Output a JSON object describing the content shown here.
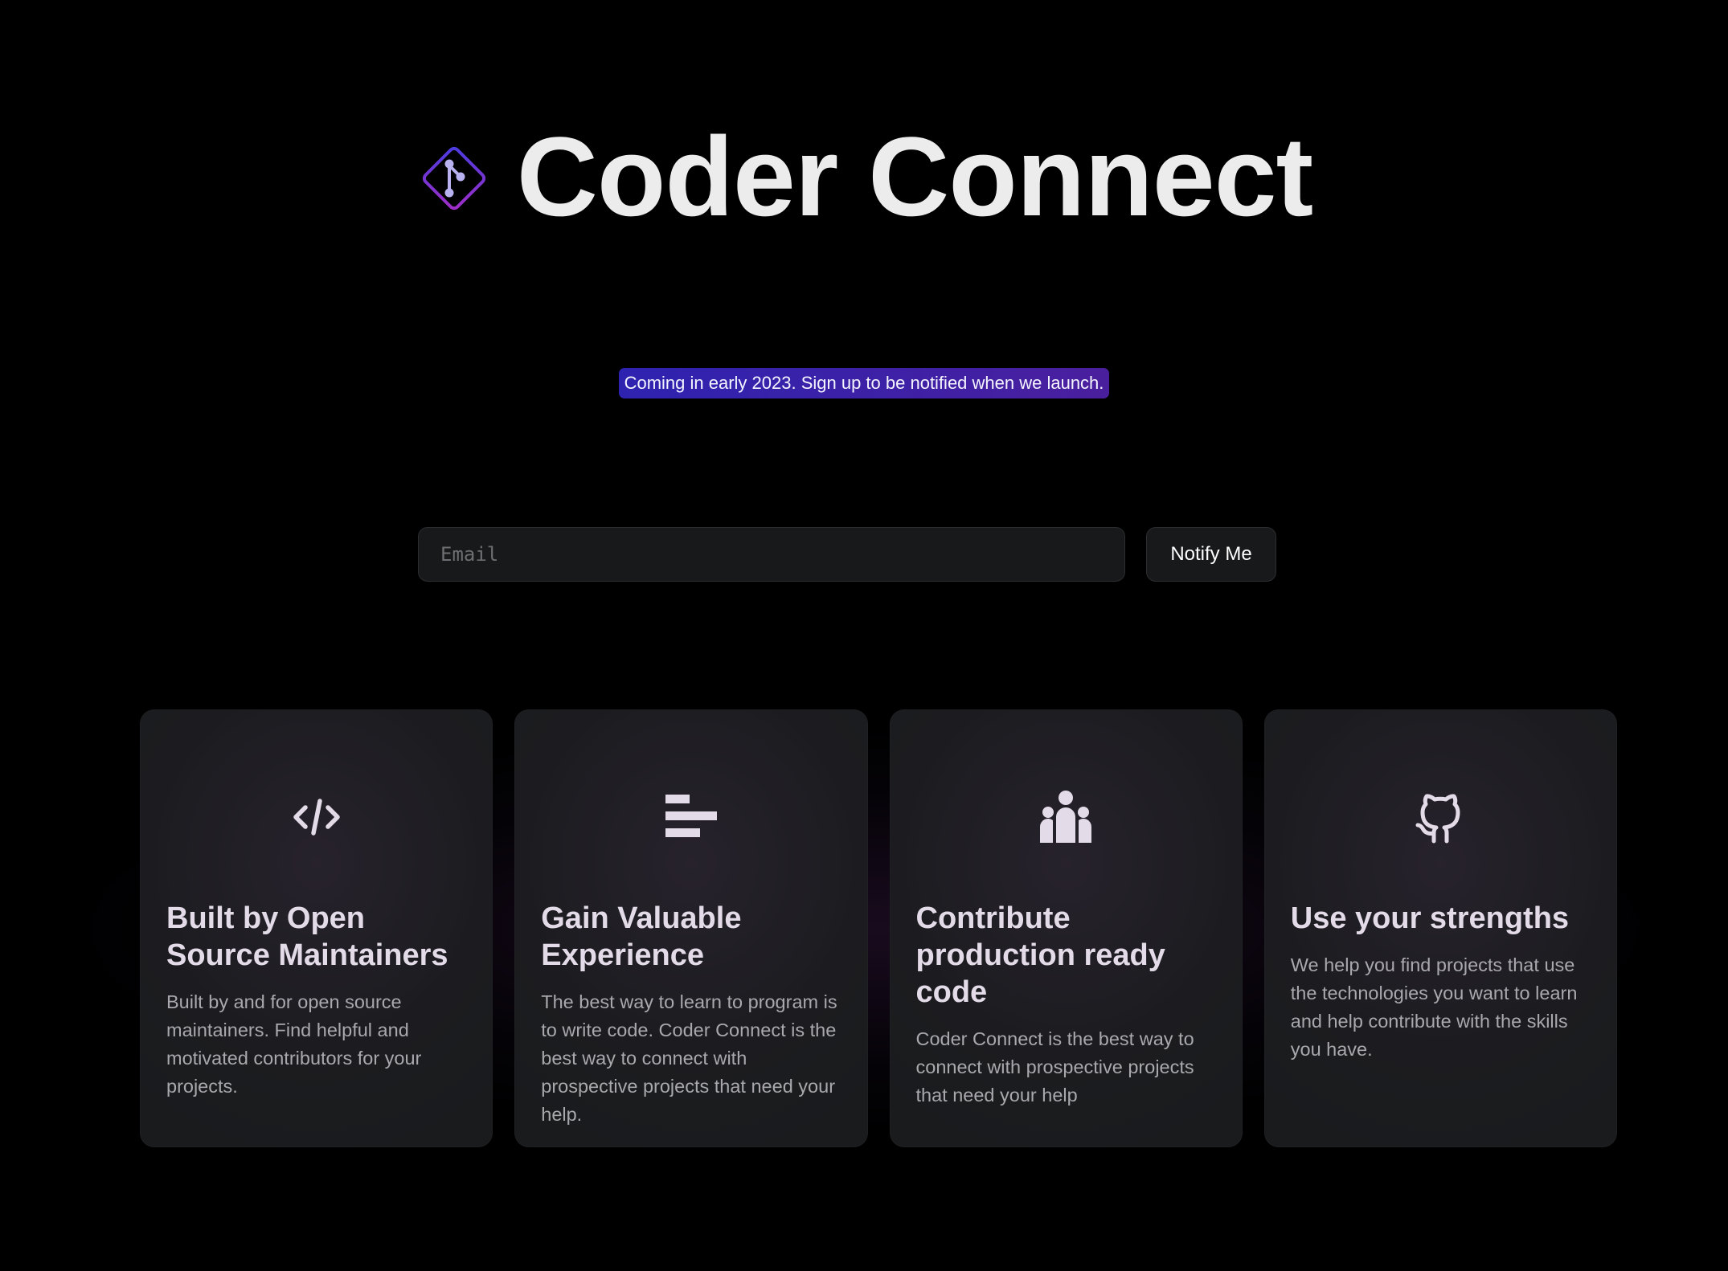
{
  "brand": {
    "name": "Coder Connect",
    "icon": "git-diamond-icon"
  },
  "announcement": {
    "text": "Coming in early 2023. Sign up to be notified when we launch."
  },
  "signup": {
    "email_placeholder": "Email",
    "email_value": "",
    "button_label": "Notify Me"
  },
  "features": [
    {
      "icon": "code-icon",
      "title": "Built by Open Source Maintainers",
      "text": "Built by and for open source maintainers. Find helpful and motivated contributors for your projects."
    },
    {
      "icon": "align-left-bars-icon",
      "title": "Gain Valuable Experience",
      "text": "The best way to learn to program is to write code. Coder Connect is the best way to connect with prospective projects that need your help."
    },
    {
      "icon": "users-group-icon",
      "title": "Contribute production ready code",
      "text": "Coder Connect is the best way to connect with prospective projects that need your help"
    },
    {
      "icon": "github-icon",
      "title": "Use your strengths",
      "text": "We help you find projects that use the technologies you want to learn and help contribute with the skills you have."
    }
  ],
  "colors": {
    "background": "#000000",
    "card_background": "#1a1b1d",
    "badge_gradient_start": "#2e23b0",
    "badge_gradient_end": "#4a1f9e",
    "logo_gradient_start": "#4a3ce0",
    "logo_gradient_end": "#9a2ec8",
    "heading_text": "#ececec",
    "card_title": "#e3dbe8",
    "card_body": "#a9a8ad"
  }
}
